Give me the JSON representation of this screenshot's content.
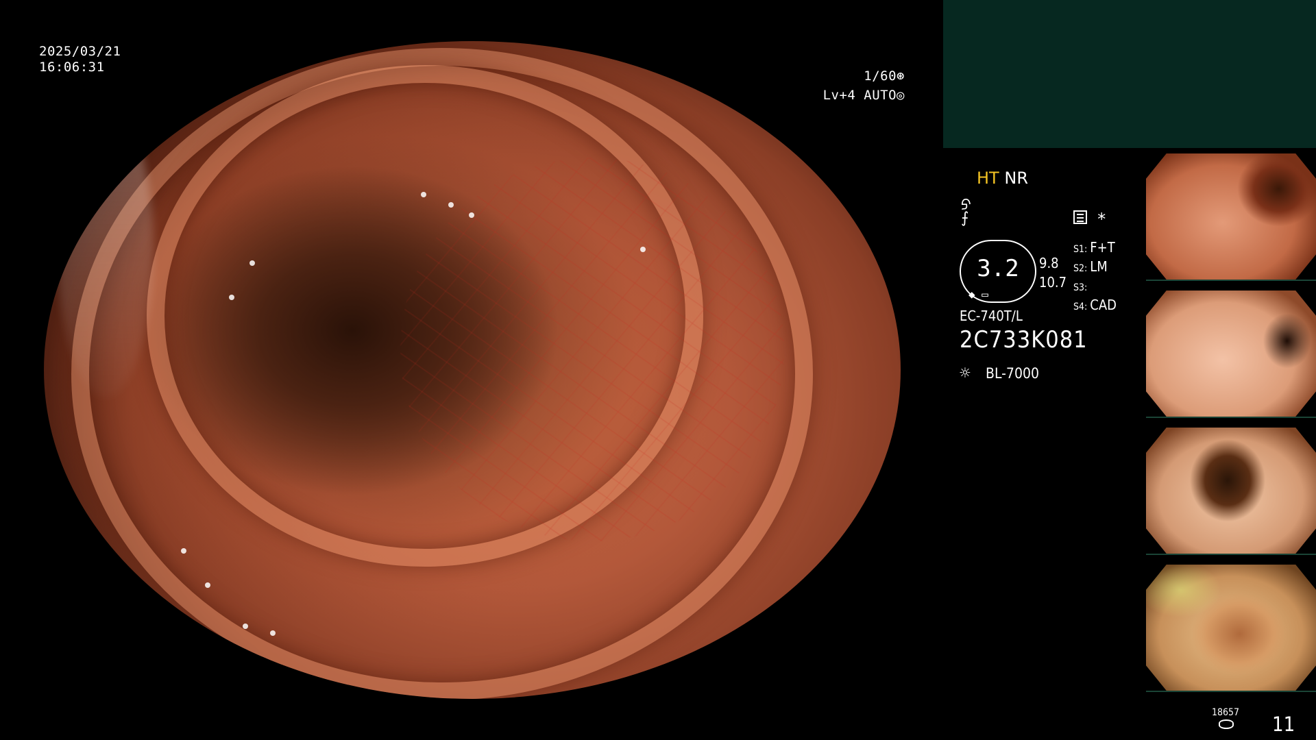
{
  "overlay": {
    "date": "2025/03/21",
    "time": "16:06:31",
    "shutter": "1/60⊛",
    "iris_level": "Lv+4 AUTO◎"
  },
  "status": {
    "mode_ht": "HT",
    "mode_nr": "NR",
    "contrast_icon": "ᠫ",
    "noise_icon": "⨍",
    "star": "*"
  },
  "switches": {
    "s1": {
      "key": "S1:",
      "value": "F+T"
    },
    "s2": {
      "key": "S2:",
      "value": "LM"
    },
    "s3": {
      "key": "S3:",
      "value": ""
    },
    "s4": {
      "key": "S4:",
      "value": "CAD"
    }
  },
  "gauge": {
    "value": "3.2",
    "upper": "9.8",
    "lower": "10.7"
  },
  "scope": {
    "model": "EC-740T/L",
    "serial": "2C733K081",
    "light_source": "BL-7000"
  },
  "thumbnails": [
    {
      "id": 1
    },
    {
      "id": 2
    },
    {
      "id": 3
    },
    {
      "id": 4
    }
  ],
  "storage": {
    "counter": "18657",
    "frames": "11"
  },
  "colors": {
    "ht_accent": "#f3c323",
    "panel_bg": "#062820",
    "background": "#000000"
  }
}
